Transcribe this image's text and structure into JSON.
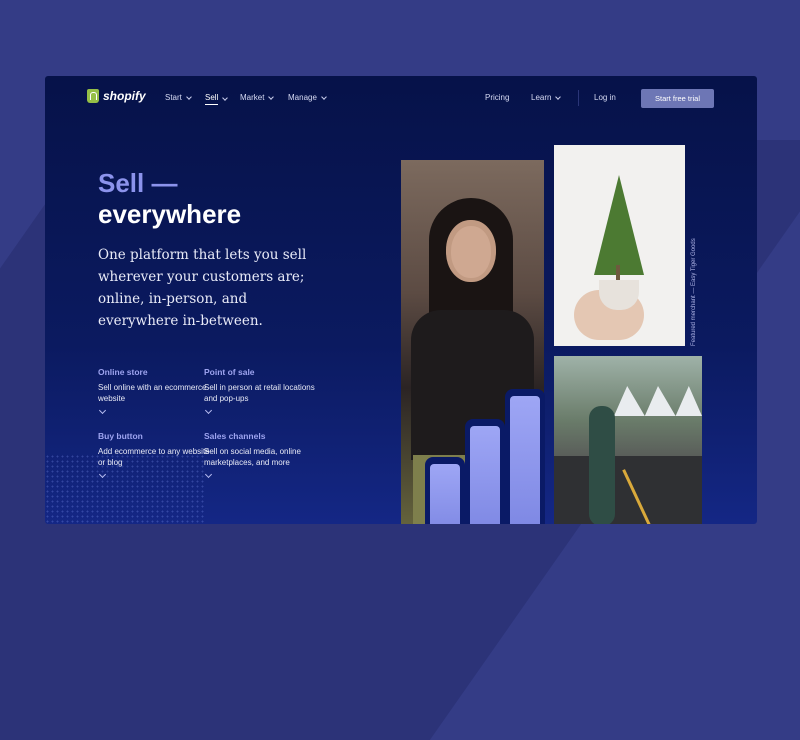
{
  "brand": {
    "name": "shopify"
  },
  "nav": {
    "items": [
      {
        "label": "Start",
        "has_caret": true
      },
      {
        "label": "Sell",
        "has_caret": true,
        "active": true
      },
      {
        "label": "Market",
        "has_caret": true
      },
      {
        "label": "Manage",
        "has_caret": true
      }
    ],
    "right": [
      {
        "label": "Pricing"
      },
      {
        "label": "Learn",
        "has_caret": true
      },
      {
        "label": "Log in"
      }
    ],
    "cta_label": "Start free trial"
  },
  "hero": {
    "heading_accent": "Sell —",
    "heading_main": "everywhere",
    "tagline": "One platform that lets you sell wherever your customers are; online, in-person, and everywhere in-between."
  },
  "features": [
    {
      "title": "Online store",
      "desc": "Sell online with an ecommerce website"
    },
    {
      "title": "Point of sale",
      "desc": "Sell in person at retail locations and pop-ups"
    },
    {
      "title": "Buy button",
      "desc": "Add ecommerce to any website or blog"
    },
    {
      "title": "Sales channels",
      "desc": "Sell on social media, online marketplaces, and more"
    }
  ],
  "caption": "Featured merchant — Easy Tiger Goods",
  "growth_bars": {
    "levels": [
      0.55,
      0.8,
      1.0
    ]
  },
  "colors": {
    "background": "#343c86",
    "card": "#061249",
    "accent": "#8c93ec",
    "cta": "#6d76b5",
    "logo_green": "#95bf47"
  }
}
